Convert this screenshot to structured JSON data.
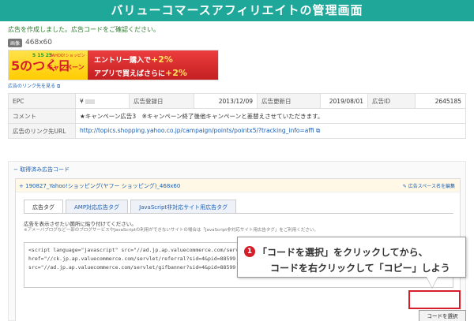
{
  "header": {
    "title": "バリューコマースアフィリエイトの管理画面"
  },
  "message": "広告を作成しました。広告コードをご確認ください。",
  "ad_preview": {
    "badge": "画像",
    "size": "468x60",
    "banner": {
      "main_text": "5のつく日",
      "campaign": "キャンペーン",
      "yahoo": "YAHOO!ショッピング",
      "nums": "5 15 25",
      "line1_text": "エントリー購入で",
      "line1_pct": "+2%",
      "line2_text": "アプリで買えばさらに",
      "line2_pct": "+2%"
    },
    "link_check": "広告のリンク先を見る"
  },
  "info_table": {
    "epc_label": "EPC",
    "epc_value": "¥ ",
    "reg_date_label": "広告登録日",
    "reg_date_value": "2013/12/09",
    "update_label": "広告更新日",
    "update_value": "2019/08/01",
    "id_label": "広告ID",
    "id_value": "2645185",
    "comment_label": "コメント",
    "comment_value": "★キャンペーン広告3　※キャンペーン終了後他キャンペーンと差替えさせていただきます。",
    "url_label": "広告のリンク先URL",
    "url_value": "http://topics.shopping.yahoo.co.jp/campaign/points/pointx5/?tracking_info=affi"
  },
  "acquired": {
    "title": "取得済み広告コード",
    "ad_name": "190827_Yahoo!ショッピング(ヤフー ショッピング)_468x60",
    "edit": "広告スペース名を編集",
    "tabs": [
      "広告タグ",
      "AMP対応広告タグ",
      "JavaScript非対応サイト用広告タグ"
    ],
    "instruction": "広告を表示させたい箇所に貼り付けてください。",
    "note": "※アメーバブログなど一部のブログサービスやJavaScriptの利用ができないサイトの場合は「JavaScript非対応サイト用広告タグ」をご利用ください。",
    "code_lines": [
      "<script language=\"javascript\" src=\"//ad.jp.ap.valuecommerce.com/servlet/",
      "href=\"//ck.jp.ap.valuecommerce.com/servlet/referral?sid=4&pid=88599",
      "src=\"//ad.jp.ap.valuecommerce.com/servlet/gifbanner?sid=4&pid=88599"
    ],
    "select_button": "コードを選択"
  },
  "callout": {
    "number": "1",
    "line1": "「コードを選択」をクリックしてから、",
    "line2": "コードを右クリックして「コピー」しよう"
  }
}
